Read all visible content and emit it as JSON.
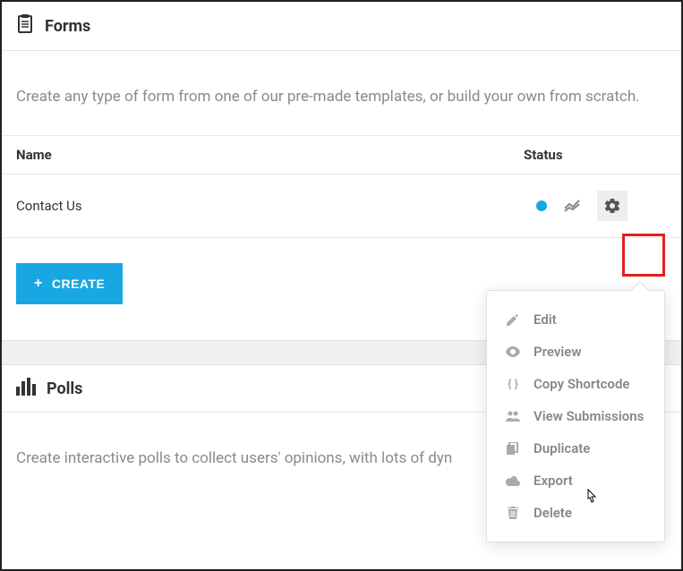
{
  "forms": {
    "title": "Forms",
    "description": "Create any type of form from one of our pre-made templates, or build your own from scratch.",
    "columns": {
      "name": "Name",
      "status": "Status"
    },
    "rows": [
      {
        "name": "Contact Us"
      }
    ],
    "create_label": "CREATE"
  },
  "polls": {
    "title": "Polls",
    "description": "Create interactive polls to collect users' opinions, with lots of dyn"
  },
  "dropdown": {
    "items": [
      {
        "icon": "pencil",
        "label": "Edit"
      },
      {
        "icon": "eye",
        "label": "Preview"
      },
      {
        "icon": "braces",
        "label": "Copy Shortcode"
      },
      {
        "icon": "users",
        "label": "View Submissions"
      },
      {
        "icon": "copy",
        "label": "Duplicate"
      },
      {
        "icon": "cloud",
        "label": "Export"
      },
      {
        "icon": "trash",
        "label": "Delete"
      }
    ]
  }
}
